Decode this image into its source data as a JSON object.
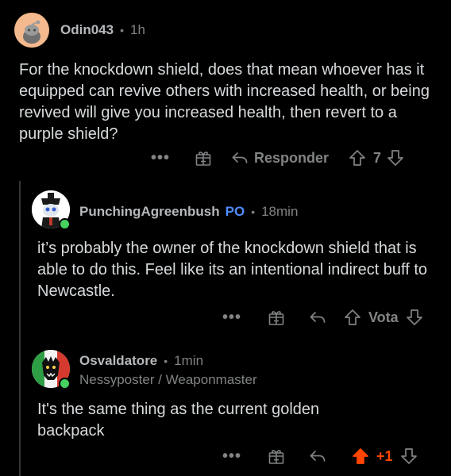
{
  "comments": [
    {
      "username": "Odin043",
      "time": "1h",
      "text": "For the knockdown shield, does that mean whoever has it equipped can revive others with increased health, or being revived will give you increased health, then revert to a purple shield?",
      "more": "•••",
      "reply_label": "Responder",
      "votes": "7"
    },
    {
      "username": "PunchingAgreenbush",
      "badge": "PO",
      "time": "18min",
      "text": "it’s probably the owner of the knockdown shield that is able to do this. Feel like its an intentional indirect buff to Newcastle.",
      "more": "•••",
      "vote_label": "Vota"
    },
    {
      "username": "Osvaldatore",
      "time": "1min",
      "flair": "Nessyposter / Weaponmaster",
      "text": "It's the same thing as the current golden backpack",
      "more": "•••",
      "votes": "+1"
    }
  ],
  "colors": {
    "background": "#000000",
    "text": "#d7dadc",
    "muted": "#818384",
    "po_blue": "#4f8cff",
    "upvote_orange": "#ff4500",
    "online_green": "#46d160"
  },
  "icons": [
    "snoo-avatar-icon",
    "gift-award-icon",
    "reply-arrow-icon",
    "upvote-arrow-icon",
    "downvote-arrow-icon",
    "online-indicator-icon"
  ]
}
